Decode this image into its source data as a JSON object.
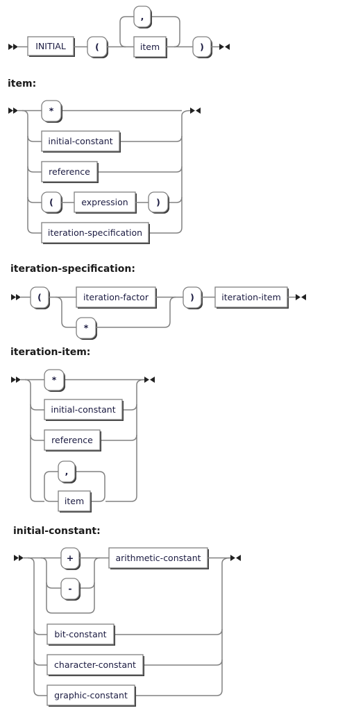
{
  "diagrams": {
    "initial": {
      "keyword": "INITIAL",
      "open_paren": "(",
      "separator": ",",
      "item": "item",
      "close_paren": ")"
    },
    "item": {
      "heading": "item:",
      "choices": [
        "*",
        "initial-constant",
        "reference",
        "expression",
        "iteration-specification"
      ],
      "open_paren": "(",
      "close_paren": ")"
    },
    "iteration_specification": {
      "heading": "iteration-specification:",
      "open_paren": "(",
      "factor": "iteration-factor",
      "star": "*",
      "close_paren": ")",
      "iteration_item": "iteration-item"
    },
    "iteration_item": {
      "heading": "iteration-item:",
      "star": "*",
      "initial_constant": "initial-constant",
      "reference": "reference",
      "separator": ",",
      "item": "item"
    },
    "initial_constant": {
      "heading": "initial-constant:",
      "plus": "+",
      "minus": "-",
      "arithmetic": "arithmetic-constant",
      "bit": "bit-constant",
      "character": "character-constant",
      "graphic": "graphic-constant"
    }
  }
}
